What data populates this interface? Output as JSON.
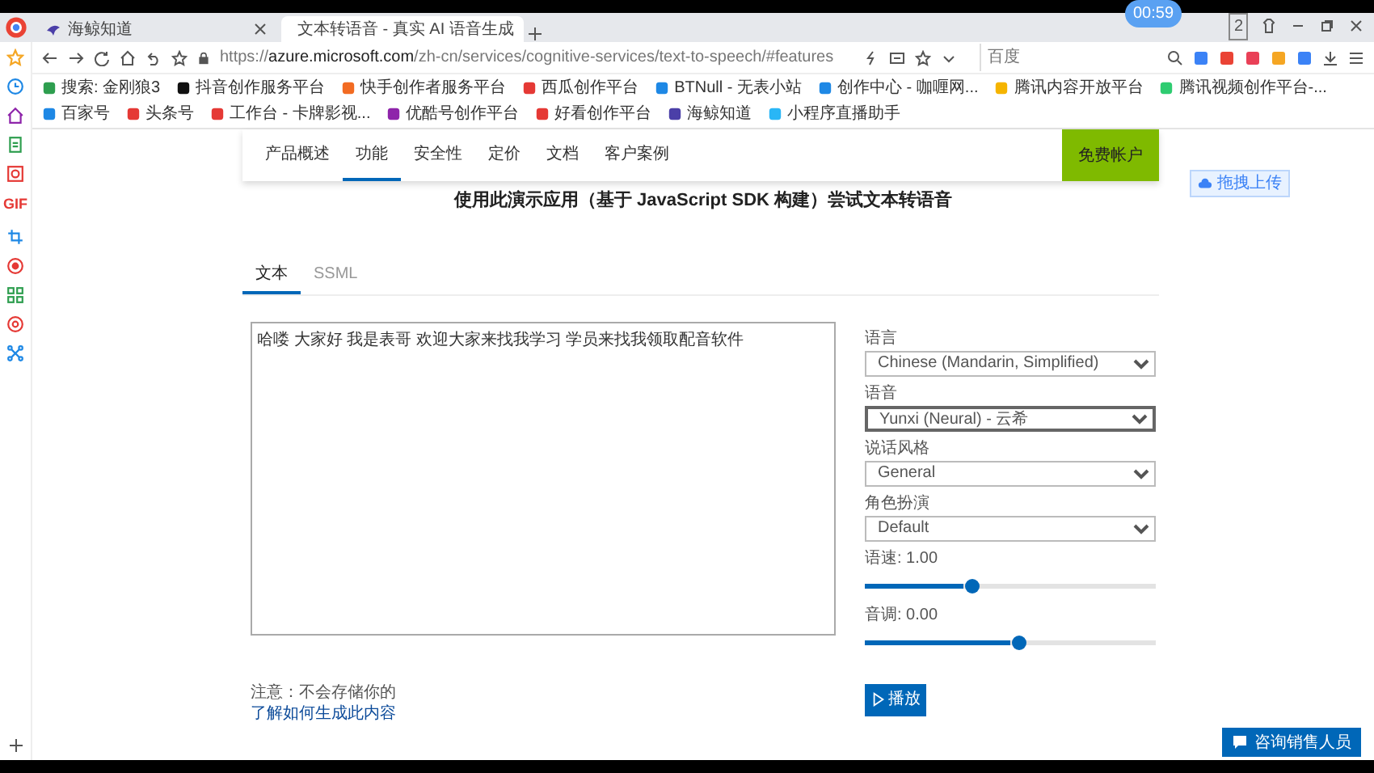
{
  "browser": {
    "tabs": [
      {
        "title": "海鲸知道",
        "selected": false
      },
      {
        "title": "文本转语音 - 真实 AI 语音生成",
        "selected": true
      }
    ],
    "timer": "00:59",
    "tab_count": "2",
    "address": "https://**azure.microsoft.com**/zh-cn/services/cognitive-services/text-to-speech/#features",
    "search_placeholder": "百度",
    "bookmarks": [
      "搜索: 金刚狼3",
      "抖音创作服务平台",
      "快手创作者服务平台",
      "西瓜创作平台",
      "BTNull - 无表小站",
      "创作中心 - 咖喱网...",
      "腾讯内容开放平台",
      "腾讯视频创作平台-...",
      "百家号",
      "头条号",
      "工作台 - 卡牌影视...",
      "优酷号创作平台",
      "好看创作平台",
      "海鲸知道",
      "小程序直播助手"
    ]
  },
  "sidebar": {
    "gif_label": "GIF"
  },
  "page": {
    "nav": [
      {
        "label": "产品概述",
        "selected": false
      },
      {
        "label": "功能",
        "selected": true
      },
      {
        "label": "安全性",
        "selected": false
      },
      {
        "label": "定价",
        "selected": false
      },
      {
        "label": "文档",
        "selected": false
      },
      {
        "label": "客户案例",
        "selected": false
      }
    ],
    "cta": "免费帐户",
    "upload_badge": "拖拽上传",
    "heading": "使用此演示应用（基于 JavaScript SDK 构建）尝试文本转语音",
    "input_tabs": [
      {
        "label": "文本",
        "selected": true
      },
      {
        "label": "SSML",
        "selected": false
      }
    ],
    "text": "哈喽 大家好 我是表哥 欢迎大家来找我学习 学员来找我领取配音软件",
    "fields": [
      {
        "kind": "select",
        "label": "语言",
        "value": "Chinese (Mandarin, Simplified)",
        "focused": false
      },
      {
        "kind": "select",
        "label": "语音",
        "value": "Yunxi (Neural) - 云希",
        "focused": true
      },
      {
        "kind": "select",
        "label": "说话风格",
        "value": "General",
        "focused": false
      },
      {
        "kind": "select",
        "label": "角色扮演",
        "value": "Default",
        "focused": false
      },
      {
        "kind": "slider",
        "label": "语速: 1.00",
        "level": 0.34
      },
      {
        "kind": "slider",
        "label": "音调: 0.00",
        "level": 0.5
      }
    ],
    "play_button": "播放",
    "note": "注意：不会存储你的",
    "link": "了解如何生成此内容",
    "chat_button": "咨询销售人员"
  }
}
